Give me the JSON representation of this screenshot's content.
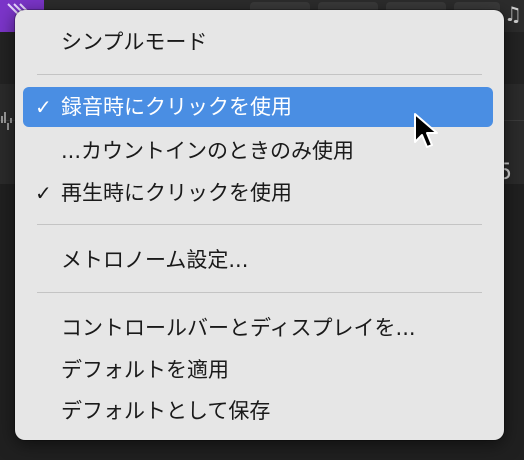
{
  "menu": {
    "items": [
      {
        "label": "シンプルモード",
        "checked": false,
        "highlighted": false
      },
      {
        "label": "録音時にクリックを使用",
        "checked": true,
        "highlighted": true
      },
      {
        "label": "...カウントインのときのみ使用",
        "checked": false,
        "highlighted": false
      },
      {
        "label": "再生時にクリックを使用",
        "checked": true,
        "highlighted": false
      },
      {
        "label": "メトロノーム設定...",
        "checked": false,
        "highlighted": false
      },
      {
        "label": "コントロールバーとディスプレイを...",
        "checked": false,
        "highlighted": false
      },
      {
        "label": "デフォルトを適用",
        "checked": false,
        "highlighted": false
      },
      {
        "label": "デフォルトとして保存",
        "checked": false,
        "highlighted": false
      }
    ],
    "check_glyph": "✓"
  },
  "background": {
    "partial_digit": "5"
  },
  "colors": {
    "menu_background": "#e6e6e6",
    "highlight": "#4a8ee3",
    "text": "#1a1a1a",
    "highlight_text": "#ffffff"
  }
}
